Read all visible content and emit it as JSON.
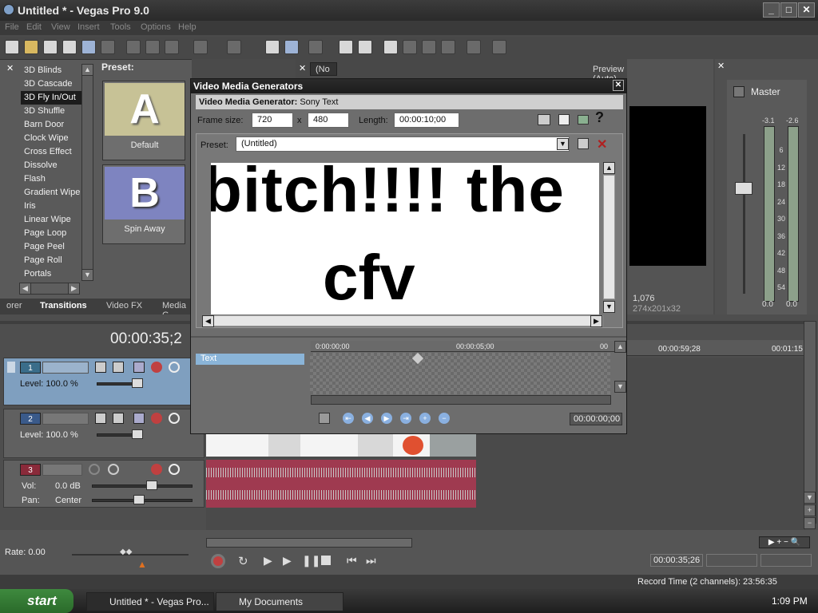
{
  "window": {
    "title": "Untitled * - Vegas Pro 9.0"
  },
  "menu": [
    "File",
    "Edit",
    "View",
    "Insert",
    "Tools",
    "Options",
    "Help"
  ],
  "transitions": {
    "items": [
      "3D Blinds",
      "3D Cascade",
      "3D Fly In/Out",
      "3D Shuffle",
      "Barn Door",
      "Clock Wipe",
      "Cross Effect",
      "Dissolve",
      "Flash",
      "Gradient Wipe",
      "Iris",
      "Linear Wipe",
      "Page Loop",
      "Page Peel",
      "Page Roll",
      "Portals"
    ],
    "selected_index": 2,
    "preset_label": "Preset:",
    "presets": [
      {
        "letter": "A",
        "label": "Default"
      },
      {
        "letter": "B",
        "label": "Spin Away"
      }
    ]
  },
  "tabs": [
    "orer",
    "Transitions",
    "Video FX",
    "Media G"
  ],
  "preview": {
    "mode": "Preview (Auto)",
    "selector": "(No",
    "frame_number": "1,076",
    "display_size": "274x201x32"
  },
  "master": {
    "label": "Master",
    "peak_l": "-3.1",
    "peak_r": "-2.6",
    "scale": [
      "6",
      "12",
      "18",
      "24",
      "30",
      "36",
      "42",
      "48",
      "54"
    ],
    "level_l": "0.0",
    "level_r": "0.0"
  },
  "dialog": {
    "title": "Video Media Generators",
    "header_label": "Video Media Generator:",
    "header_value": "Sony Text",
    "frame_size_label": "Frame size:",
    "width": "720",
    "x_label": "x",
    "height": "480",
    "length_label": "Length:",
    "length": "00:00:10;00",
    "preset_label": "Preset:",
    "preset_value": "(Untitled)",
    "text_line1": "bitch!!!! the",
    "text_line2": "cfv",
    "kf_track": "Text",
    "kf_t0": "0:00:00;00",
    "kf_t1": "00:00:05;00",
    "kf_t2": "00",
    "kf_time": "00:00:00;00"
  },
  "timeline": {
    "cursor_time": "00:00:35;2",
    "ruler_t1": "00:00:59;28",
    "ruler_t2": "00:01:15",
    "tracks": [
      {
        "num": "1",
        "level_label": "Level: 100.0 %"
      },
      {
        "num": "2",
        "level_label": "Level: 100.0 %"
      },
      {
        "num": "3",
        "vol_label": "Vol:",
        "vol_value": "0.0 dB",
        "pan_label": "Pan:",
        "pan_value": "Center"
      }
    ]
  },
  "transport": {
    "rate_label": "Rate: 0.00",
    "time": "00:00:35;26",
    "record_time": "Record Time (2 channels): 23:56:35"
  },
  "taskbar": {
    "start": "start",
    "tasks": [
      "Untitled * - Vegas Pro...",
      "My Documents"
    ],
    "clock": "1:09 PM"
  }
}
